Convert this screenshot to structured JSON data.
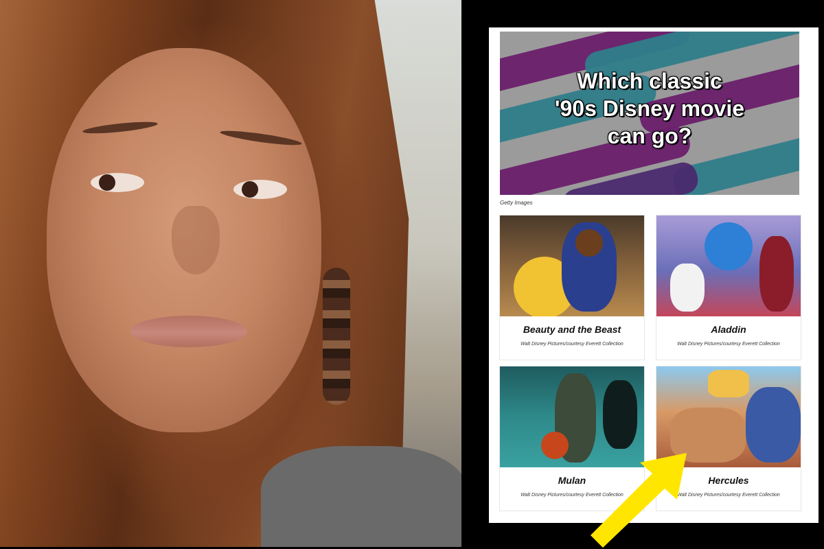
{
  "screenshot": {
    "hero": {
      "title_lines": [
        "Which classic",
        "'90s Disney movie",
        "can go?"
      ],
      "credit": "Getty Images"
    },
    "options": [
      {
        "name": "Beauty and the Beast",
        "credit": "Walt Disney Pictures/courtesy Everett Collection"
      },
      {
        "name": "Aladdin",
        "credit": "Walt Disney Pictures/courtesy Everett Collection"
      },
      {
        "name": "Mulan",
        "credit": "Walt Disney Pictures/courtesy Everett Collection"
      },
      {
        "name": "Hercules",
        "credit": "Walt Disney Pictures/courtesy Everett Collection"
      }
    ]
  },
  "colors": {
    "accent_purple": "#6a1f6b",
    "accent_teal": "#2f7d8a",
    "arrow_yellow": "#ffe600"
  },
  "icons": {
    "pointer": "arrow-icon"
  }
}
